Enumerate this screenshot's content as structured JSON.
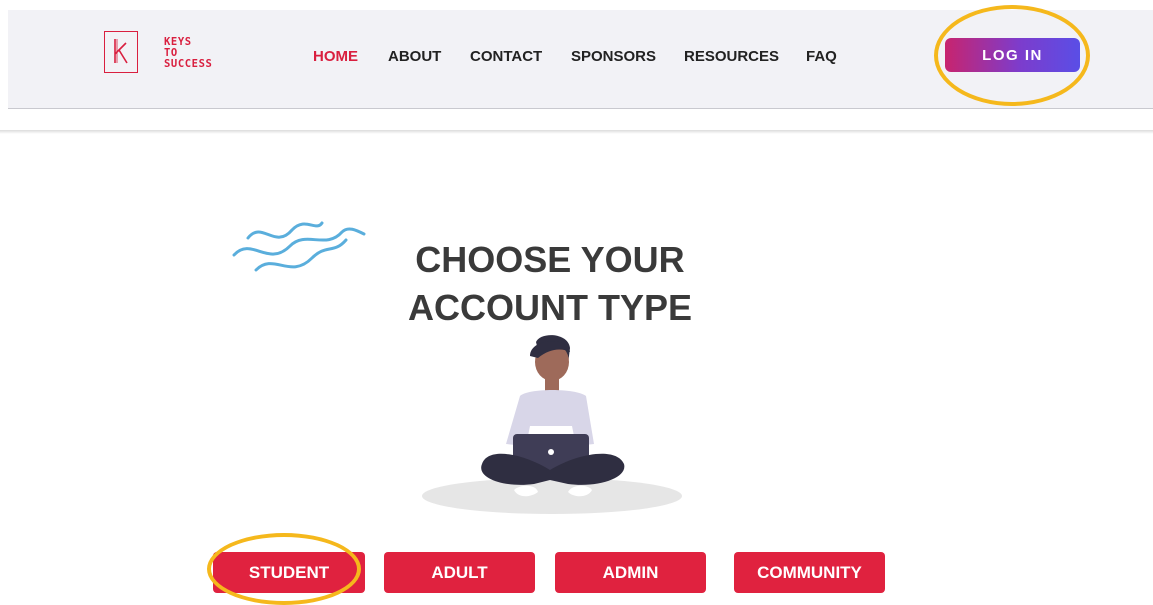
{
  "brand": {
    "logo_letter": "k",
    "name_lines": [
      "KEYS",
      "TO",
      "SUCCESS"
    ]
  },
  "nav": {
    "items": [
      {
        "label": "HOME",
        "active": true
      },
      {
        "label": "ABOUT"
      },
      {
        "label": "CONTACT"
      },
      {
        "label": "SPONSORS"
      },
      {
        "label": "RESOURCES"
      },
      {
        "label": "FAQ"
      }
    ],
    "login_label": "LOG IN"
  },
  "main": {
    "headline_line1": "CHOOSE YOUR",
    "headline_line2": "ACCOUNT TYPE",
    "account_types": [
      "STUDENT",
      "ADULT",
      "ADMIN",
      "COMMUNITY"
    ]
  },
  "theme": {
    "accent": "#e0223f",
    "highlight_ring": "#f5b81c",
    "login_gradient": [
      "#c8246e",
      "#5a4ee6"
    ]
  }
}
